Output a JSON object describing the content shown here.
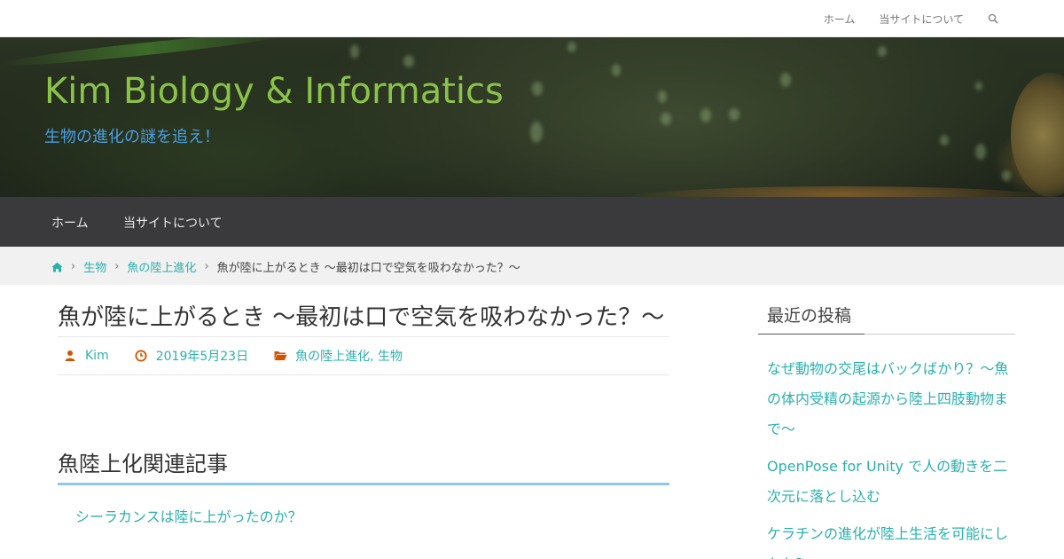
{
  "topbar": {
    "nav": [
      "ホーム",
      "当サイトについて"
    ],
    "search_icon": "search-icon"
  },
  "header": {
    "site_title": "Kim Biology & Informatics",
    "tagline": "生物の進化の謎を追え！",
    "title_color": "#8bc34a",
    "tagline_color": "#4a9fe0"
  },
  "mainnav": {
    "items": [
      "ホーム",
      "当サイトについて"
    ]
  },
  "breadcrumb": {
    "home_icon": "home-icon",
    "items": [
      "生物",
      "魚の陸上進化"
    ],
    "current": "魚が陸に上がるとき 〜最初は口で空気を吸わなかった？〜"
  },
  "article": {
    "title": "魚が陸に上がるとき 〜最初は口で空気を吸わなかった？〜",
    "author": "Kim",
    "date": "2019年5月23日",
    "categories": "魚の陸上進化, 生物",
    "related_heading": "魚陸上化関連記事",
    "related": [
      "シーラカンスは陸に上がったのか？"
    ]
  },
  "sidebar": {
    "widget_title": "最近の投稿",
    "posts": [
      "なぜ動物の交尾はバックばかり？～魚の体内受精の起源から陸上四肢動物まで～",
      "OpenPose for Unity で人の動きを二次元に落とし込む",
      "ケラチンの進化が陸上生活を可能にしたか？"
    ]
  },
  "colors": {
    "link": "#2ab1ad",
    "nav_bg": "#3a3a3c",
    "accent_underline": "#8ec9e6",
    "meta_icon": "#d35400"
  }
}
